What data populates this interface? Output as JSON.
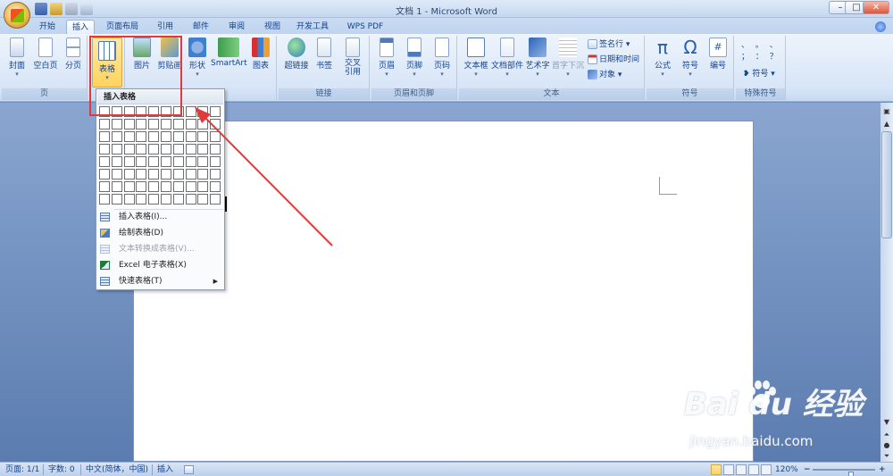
{
  "window": {
    "title": "文档 1 - Microsoft Word",
    "controls": [
      "–",
      "□",
      "✕"
    ]
  },
  "tabs": [
    {
      "label": "开始",
      "active": false
    },
    {
      "label": "插入",
      "active": true
    },
    {
      "label": "页面布局",
      "active": false
    },
    {
      "label": "引用",
      "active": false
    },
    {
      "label": "邮件",
      "active": false
    },
    {
      "label": "审阅",
      "active": false
    },
    {
      "label": "视图",
      "active": false
    },
    {
      "label": "开发工具",
      "active": false
    },
    {
      "label": "WPS PDF",
      "active": false
    }
  ],
  "ribbon": {
    "groups": [
      "页",
      "链接",
      "页眉和页脚",
      "文本",
      "符号",
      "特殊符号"
    ],
    "pages": [
      "封面",
      "空白页",
      "分页"
    ],
    "table": "表格",
    "illustrations": [
      "图片",
      "剪贴画",
      "形状",
      "SmartArt",
      "图表"
    ],
    "links": [
      "超链接",
      "书签",
      "交叉\n引用"
    ],
    "header_footer": [
      "页眉",
      "页脚",
      "页码"
    ],
    "text": [
      "文本框",
      "文档部件",
      "艺术字",
      "首字下沉"
    ],
    "text_small": [
      "签名行",
      "日期和时间",
      "对象"
    ],
    "symbols": [
      "公式",
      "符号",
      "编号"
    ],
    "special_symbol": "符号",
    "special_chars": "、 。 、 ； ： ？"
  },
  "dropdown": {
    "header": "插入表格",
    "grid_cols": 10,
    "grid_rows": 8,
    "items": [
      {
        "label": "插入表格(I)...",
        "disabled": false,
        "submenu": false
      },
      {
        "label": "绘制表格(D)",
        "disabled": false,
        "submenu": false
      },
      {
        "label": "文本转换成表格(V)...",
        "disabled": true,
        "submenu": false
      },
      {
        "label": "Excel 电子表格(X)",
        "disabled": false,
        "submenu": false
      },
      {
        "label": "快速表格(T)",
        "disabled": false,
        "submenu": true
      }
    ]
  },
  "statusbar": {
    "page": "页面: 1/1",
    "words": "字数: 0",
    "language": "中文(简体，中国)",
    "mode": "插入",
    "zoom": "120%",
    "zoom_minus": "−",
    "zoom_plus": "+"
  },
  "watermark": {
    "brand": "Bai  du 经验",
    "url": "jingyan.baidu.com"
  },
  "colors": {
    "highlight": "#e23a3a",
    "ribbon": "#dbe7f8",
    "workspace": "#6f8fbf"
  },
  "icons": {
    "office_button": "office-logo-icon",
    "save": "save-icon",
    "undo": "undo-icon",
    "redo": "redo-icon"
  }
}
